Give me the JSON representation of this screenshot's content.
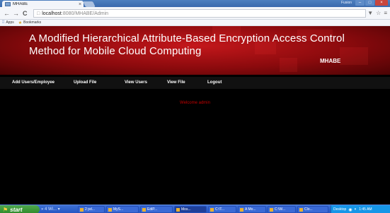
{
  "browser": {
    "tab_title": "MHABE",
    "tab_close": "×",
    "window_user": "Fusion",
    "win_minimize": "–",
    "win_maximize": "□",
    "win_close": "×",
    "back_glyph": "←",
    "forward_glyph": "→",
    "reload_glyph": "C",
    "url_host": "localhost",
    "url_path": ":8080/MHABE/Admin",
    "star_glyph": "☆",
    "menu_glyph": "≡",
    "funnel_glyph": "▼",
    "bookmarks": {
      "apps": "Apps",
      "bookmarks": "Bookmarks"
    }
  },
  "page": {
    "title": "A Modified Hierarchical Attribute-Based Encryption Access Control Method for Mobile Cloud Computing",
    "subtitle": "MHABE",
    "nav": [
      {
        "label": "Add Users/Employee"
      },
      {
        "label": "Upload File"
      },
      {
        "label": "View Users"
      },
      {
        "label": "View File"
      },
      {
        "label": "Logout"
      }
    ],
    "welcome": "Welcome admin"
  },
  "taskbar": {
    "start": "start",
    "quick_launch": "» 4 Wi... ▾",
    "tasks": [
      {
        "label": "2 pd..."
      },
      {
        "label": "MyS..."
      },
      {
        "label": "EdiP..."
      },
      {
        "label": "Mos..."
      },
      {
        "label": "C:\\T..."
      },
      {
        "label": "A Mo..."
      },
      {
        "label": "C:\\W..."
      },
      {
        "label": "Clo..."
      }
    ],
    "tray_text": "Desktop",
    "clock": "1:45 AM"
  }
}
